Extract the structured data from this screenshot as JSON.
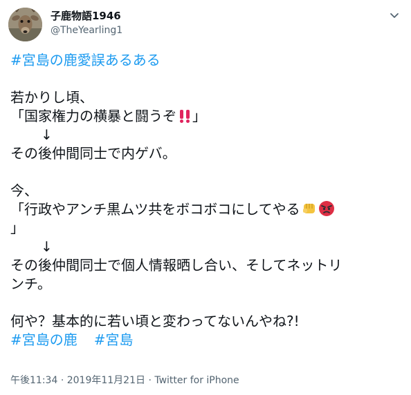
{
  "author": {
    "display_name": "子鹿物語1946",
    "handle": "@TheYearling1"
  },
  "tweet": {
    "headline_tag": "#宮島の鹿愛誤あるある",
    "lines": {
      "l1": "若かりし頃、",
      "l2": "「国家権力の横暴と闘うぞ",
      "l2_close": "」",
      "l3": "↓",
      "l4": "その後仲間同士で内ゲバ。",
      "l6": "今、",
      "l7": "「行政やアンチ黒ムツ共をボコボコにしてやる",
      "l8": "」",
      "l9": "↓",
      "l10": "その後仲間同士で個人情報晒し合い、そしてネットリ",
      "l11": "ンチ。",
      "l13": "何や？基本的に若い頃と変わってないんやね?!"
    },
    "tags": [
      "#宮島の鹿",
      "#宮島"
    ],
    "emoji": {
      "double_exclamation": "double-exclamation-icon",
      "fist": "oncoming-fist-icon",
      "angry": "angry-face-icon"
    }
  },
  "meta": {
    "time": "午後11:34",
    "separator1": "·",
    "date": "2019年11月21日",
    "separator2": "·",
    "source": "Twitter for iPhone"
  },
  "colors": {
    "link": "#1d9bf0",
    "text": "#0f1419",
    "muted": "#536471",
    "exclamation": "#e0245e",
    "fist": "#f4c43f",
    "angry": "#dd2e44"
  }
}
